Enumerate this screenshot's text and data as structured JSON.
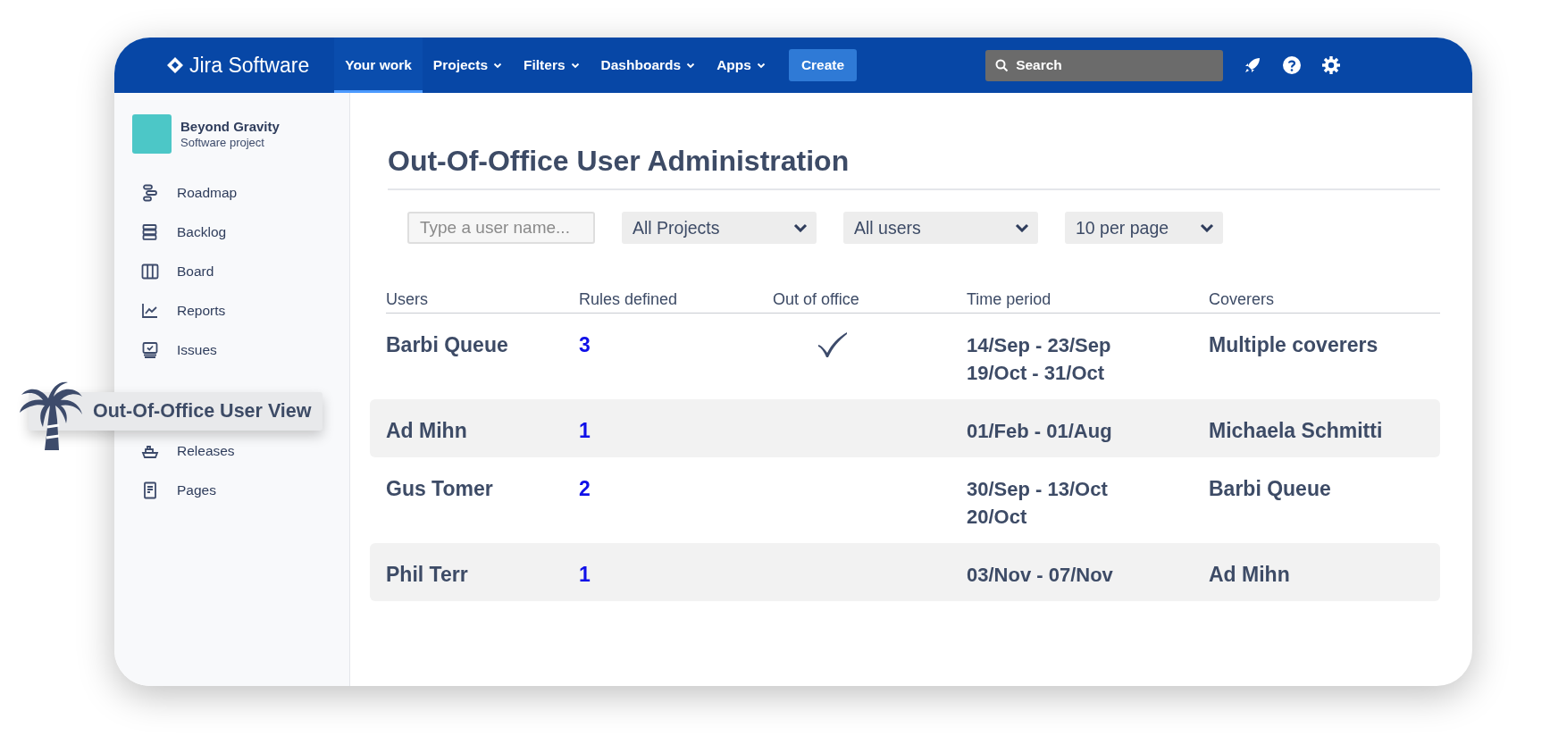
{
  "nav": {
    "logo": "Jira Software",
    "items": [
      {
        "label": "Your work",
        "selected": true,
        "dropdown": false
      },
      {
        "label": "Projects",
        "selected": false,
        "dropdown": true
      },
      {
        "label": "Filters",
        "selected": false,
        "dropdown": true
      },
      {
        "label": "Dashboards",
        "selected": false,
        "dropdown": true
      },
      {
        "label": "Apps",
        "selected": false,
        "dropdown": true
      }
    ],
    "create": "Create",
    "search": {
      "placeholder": "Search"
    }
  },
  "sidebar": {
    "project": {
      "name": "Beyond Gravity",
      "type": "Software project"
    },
    "items": [
      {
        "kind": "roadmap",
        "label": "Roadmap"
      },
      {
        "kind": "backlog",
        "label": "Backlog"
      },
      {
        "kind": "board",
        "label": "Board"
      },
      {
        "kind": "reports",
        "label": "Reports"
      },
      {
        "kind": "issues",
        "label": "Issues"
      },
      {
        "kind": "callout",
        "label": "Out-Of-Office User View"
      },
      {
        "kind": "releases",
        "label": "Releases"
      },
      {
        "kind": "pages",
        "label": "Pages"
      }
    ]
  },
  "page": {
    "title": "Out-Of-Office User Administration",
    "filters": {
      "user": {
        "placeholder": "Type a user name..."
      },
      "selects": [
        "All Projects",
        "All users",
        "10 per page"
      ]
    },
    "table": {
      "columns": [
        "Users",
        "Rules defined",
        "Out of office",
        "Time period",
        "Coverers"
      ],
      "rows": [
        {
          "user": "Barbi Queue",
          "rules": "3",
          "out_of_office": true,
          "periods": [
            "14/Sep - 23/Sep",
            "19/Oct - 31/Oct"
          ],
          "coverers": "Multiple coverers"
        },
        {
          "user": "Ad Mihn",
          "rules": "1",
          "out_of_office": false,
          "periods": [
            "01/Feb - 01/Aug"
          ],
          "coverers": "Michaela Schmitti"
        },
        {
          "user": "Gus Tomer",
          "rules": "2",
          "out_of_office": false,
          "periods": [
            "30/Sep - 13/Oct",
            "20/Oct"
          ],
          "coverers": "Barbi Queue"
        },
        {
          "user": "Phil Terr",
          "rules": "1",
          "out_of_office": false,
          "periods": [
            "03/Nov - 07/Nov"
          ],
          "coverers": "Ad Mihn"
        }
      ]
    }
  }
}
